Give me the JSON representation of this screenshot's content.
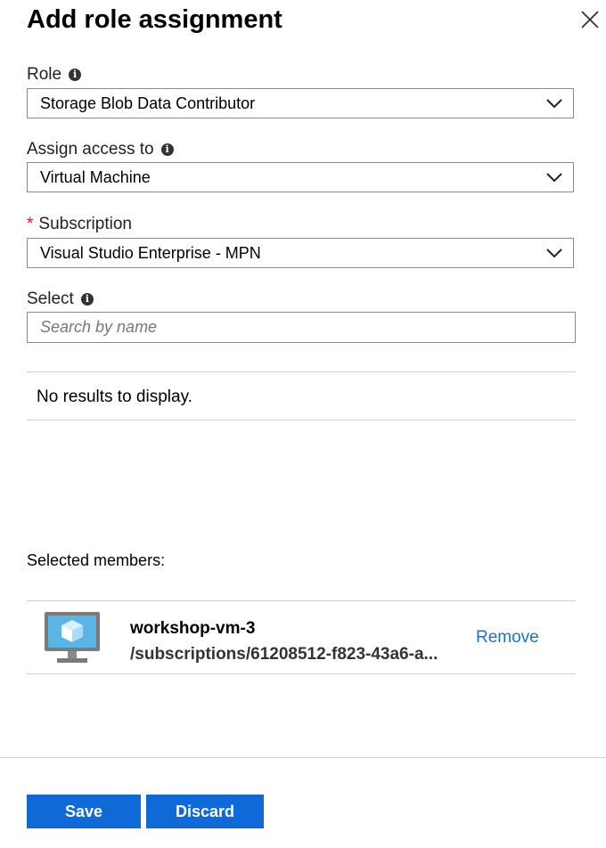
{
  "header": {
    "title": "Add role assignment",
    "close_icon": "close-icon"
  },
  "form": {
    "role": {
      "label": "Role",
      "value": "Storage Blob Data Contributor"
    },
    "assign_access": {
      "label": "Assign access to",
      "value": "Virtual Machine"
    },
    "subscription": {
      "required_mark": "*",
      "label": "Subscription",
      "value": "Visual Studio Enterprise - MPN"
    },
    "select": {
      "label": "Select",
      "placeholder": "Search by name"
    }
  },
  "results": {
    "empty_text": "No results to display."
  },
  "selected": {
    "label": "Selected members:",
    "members": [
      {
        "name": "workshop-vm-3",
        "path": "/subscriptions/61208512-f823-43a6-a...",
        "action": "Remove"
      }
    ]
  },
  "footer": {
    "save_label": "Save",
    "discard_label": "Discard"
  },
  "colors": {
    "primary": "#0f6ad8",
    "link": "#1f6fd0",
    "required": "#e81123"
  }
}
